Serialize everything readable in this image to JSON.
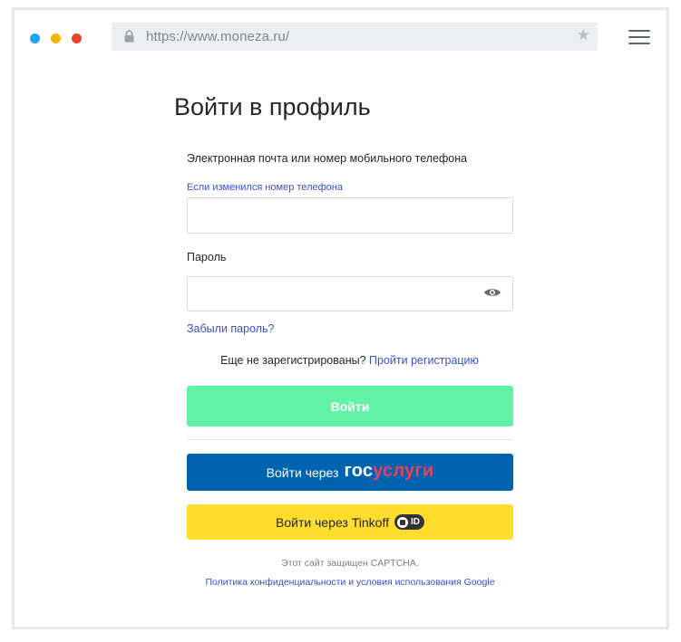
{
  "browser": {
    "url": "https://www.moneza.ru/",
    "lock_icon": "lock-icon",
    "star_icon": "star-icon",
    "menu_icon": "hamburger-menu-icon",
    "dots": [
      "#1aa4f2",
      "#f5b400",
      "#e5462a"
    ]
  },
  "form": {
    "title": "Войти в профиль",
    "email_label": "Электронная почта или номер мобильного телефона",
    "phone_changed_link": "Если изменился номер телефона",
    "email_value": "",
    "password_label": "Пароль",
    "password_value": "",
    "show_password_icon": "eye-icon",
    "forgot_password": "Забыли пароль?",
    "not_registered": "Еще не зарегистрированы?",
    "register_link": "Пройти регистрацию",
    "login_button": "Войти"
  },
  "alt_login": {
    "gosuslugi_prefix": "Войти через",
    "gosuslugi_logo_part1": "гос",
    "gosuslugi_logo_part2": "услуги",
    "tinkoff_label": "Войти через Tinkoff",
    "tinkoff_badge": "ID"
  },
  "footer": {
    "captcha_text": "Этот сайт защищен CAPTCHA.",
    "policy_link": "Политика конфиденциальности и условия использования Google"
  },
  "colors": {
    "login_button": "#62f2a6",
    "gosuslugi_button": "#0063b0",
    "tinkoff_button": "#ffdd2d",
    "link": "#3a4fd0"
  }
}
